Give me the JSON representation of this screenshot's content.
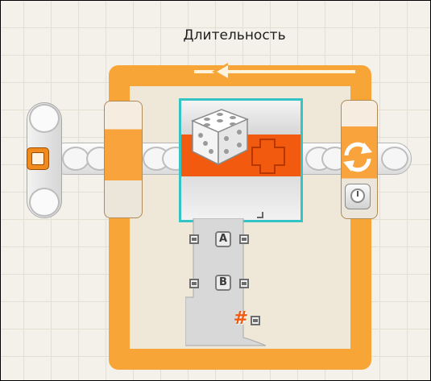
{
  "loop": {
    "title": "Длительность",
    "frame_color": "#f7a536",
    "end_icon": "loop-cycle-icon",
    "control_icon": "timer-icon"
  },
  "start": {
    "icon": "start-icon",
    "color": "#f08a1c"
  },
  "random_block": {
    "icon": "dice-icon",
    "selection_color": "#34c4c6",
    "stripe_color": "#f25a0f",
    "output_icon": "number-plug-icon"
  },
  "data_hub": {
    "ports": [
      {
        "label": "A"
      },
      {
        "label": "B"
      },
      {
        "label": "#"
      }
    ]
  }
}
